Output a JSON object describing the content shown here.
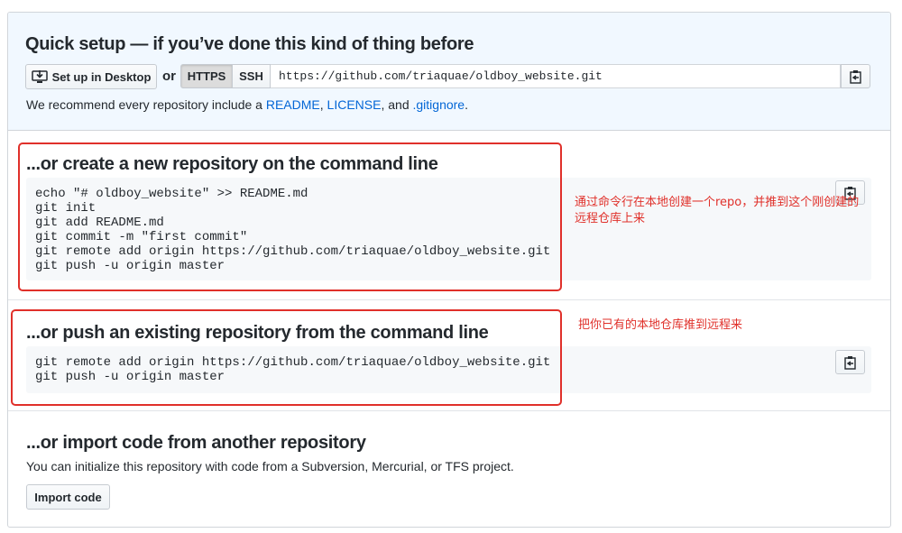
{
  "quick_setup": {
    "title": "Quick setup — if you’ve done this kind of thing before",
    "desktop_button": "Set up in Desktop",
    "or_label": "or",
    "https_label": "HTTPS",
    "ssh_label": "SSH",
    "clone_url": "https://github.com/triaquae/oldboy_website.git",
    "recommend_prefix": "We recommend every repository include a ",
    "readme": "README",
    "sep1": ", ",
    "license": "LICENSE",
    "sep2": ", and ",
    "gitignore": ".gitignore",
    "suffix": "."
  },
  "create_section": {
    "title": "...or create a new repository on the command line",
    "code": "echo \"# oldboy_website\" >> README.md\ngit init\ngit add README.md\ngit commit -m \"first commit\"\ngit remote add origin https://github.com/triaquae/oldboy_website.git\ngit push -u origin master",
    "annotation": "通过命令行在本地创建一个repo，并推到这个刚创建的\n远程仓库上来"
  },
  "push_section": {
    "title": "...or push an existing repository from the command line",
    "code": "git remote add origin https://github.com/triaquae/oldboy_website.git\ngit push -u origin master",
    "annotation": "把你已有的本地仓库推到远程来"
  },
  "import_section": {
    "title": "...or import code from another repository",
    "description": "You can initialize this repository with code from a Subversion, Mercurial, or TFS project.",
    "button": "Import code"
  },
  "icons": {
    "desktop": "desktop-download-icon",
    "clipboard": "clipboard-icon"
  },
  "colors": {
    "link": "#0366d6",
    "annotation": "#e0302a",
    "quick_bg": "#f1f8ff",
    "code_bg": "#f6f8fa"
  }
}
